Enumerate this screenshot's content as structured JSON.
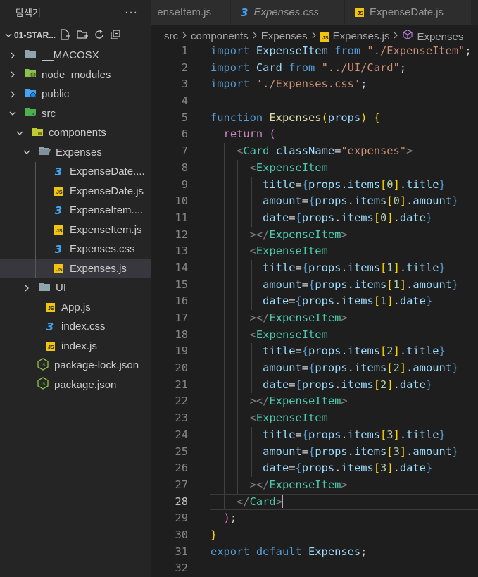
{
  "explorer": {
    "title": "탐색기",
    "more": "···",
    "section": "01-STAR...",
    "items": [
      {
        "label": "__MACOSX",
        "type": "folder",
        "depth": 1,
        "open": false,
        "icon": "folder-icon"
      },
      {
        "label": "node_modules",
        "type": "folder-node",
        "depth": 1,
        "open": false,
        "icon": "node-modules-folder-icon"
      },
      {
        "label": "public",
        "type": "folder-public",
        "depth": 1,
        "open": false,
        "icon": "public-folder-icon"
      },
      {
        "label": "src",
        "type": "folder-src",
        "depth": 1,
        "open": true,
        "icon": "src-folder-icon"
      },
      {
        "label": "components",
        "type": "folder-components",
        "depth": 2,
        "open": true,
        "icon": "components-folder-icon"
      },
      {
        "label": "Expenses",
        "type": "folder",
        "depth": 3,
        "open": true,
        "icon": "folder-open-icon"
      },
      {
        "label": "ExpenseDate....",
        "type": "css",
        "depth": 4,
        "icon": "css-file-icon"
      },
      {
        "label": "ExpenseDate.js",
        "type": "js",
        "depth": 4,
        "icon": "js-file-icon"
      },
      {
        "label": "ExpenseItem....",
        "type": "css",
        "depth": 4,
        "icon": "css-file-icon"
      },
      {
        "label": "ExpenseItem.js",
        "type": "js",
        "depth": 4,
        "icon": "js-file-icon"
      },
      {
        "label": "Expenses.css",
        "type": "css",
        "depth": 4,
        "icon": "css-file-icon"
      },
      {
        "label": "Expenses.js",
        "type": "js",
        "depth": 4,
        "icon": "js-file-icon",
        "selected": true
      },
      {
        "label": "UI",
        "type": "folder",
        "depth": 3,
        "open": false,
        "icon": "folder-icon"
      },
      {
        "label": "App.js",
        "type": "js",
        "depth": 3,
        "icon": "js-file-icon"
      },
      {
        "label": "index.css",
        "type": "css",
        "depth": 3,
        "icon": "css-file-icon"
      },
      {
        "label": "index.js",
        "type": "js",
        "depth": 3,
        "icon": "js-file-icon"
      },
      {
        "label": "package-lock.json",
        "type": "json",
        "depth": 2,
        "icon": "nodejs-file-icon"
      },
      {
        "label": "package.json",
        "type": "json",
        "depth": 2,
        "icon": "nodejs-file-icon"
      }
    ]
  },
  "tabs": [
    {
      "label": "enseItem.js",
      "icon": "js-file-icon",
      "italic": false
    },
    {
      "label": "Expenses.css",
      "icon": "css-file-icon",
      "italic": true
    },
    {
      "label": "ExpenseDate.js",
      "icon": "js-file-icon",
      "italic": false
    }
  ],
  "breadcrumbs": [
    "src",
    "components",
    "Expenses",
    "Expenses.js",
    "Expenses"
  ],
  "editor": {
    "current_line": 28,
    "lines": [
      [
        [
          "key",
          "import "
        ],
        [
          "var",
          "ExpenseItem"
        ],
        [
          "key",
          " from "
        ],
        [
          "str",
          "\"./ExpenseItem\""
        ],
        [
          "plain",
          ";"
        ]
      ],
      [
        [
          "key",
          "import "
        ],
        [
          "var",
          "Card"
        ],
        [
          "key",
          " from "
        ],
        [
          "str",
          "\"../UI/Card\""
        ],
        [
          "plain",
          ";"
        ]
      ],
      [
        [
          "key",
          "import "
        ],
        [
          "str",
          "'./Expenses.css'"
        ],
        [
          "plain",
          ";"
        ]
      ],
      [],
      [
        [
          "key",
          "function "
        ],
        [
          "fn",
          "Expenses"
        ],
        [
          "b1",
          "("
        ],
        [
          "var",
          "props"
        ],
        [
          "b1",
          ")"
        ],
        [
          "plain",
          " "
        ],
        [
          "b1",
          "{"
        ]
      ],
      [
        [
          "plain",
          "  "
        ],
        [
          "kw",
          "return "
        ],
        [
          "b2",
          "("
        ]
      ],
      [
        [
          "plain",
          "    "
        ],
        [
          "pun",
          "<"
        ],
        [
          "tag",
          "Card"
        ],
        [
          "plain",
          " "
        ],
        [
          "attr",
          "className"
        ],
        [
          "plain",
          "="
        ],
        [
          "str",
          "\"expenses\""
        ],
        [
          "pun",
          ">"
        ]
      ],
      [
        [
          "plain",
          "      "
        ],
        [
          "pun",
          "<"
        ],
        [
          "tag",
          "ExpenseItem"
        ]
      ],
      [
        [
          "plain",
          "        "
        ],
        [
          "attr",
          "title"
        ],
        [
          "plain",
          "="
        ],
        [
          "key",
          "{"
        ],
        [
          "var",
          "props"
        ],
        [
          "plain",
          "."
        ],
        [
          "var",
          "items"
        ],
        [
          "b1",
          "["
        ],
        [
          "num",
          "0"
        ],
        [
          "b1",
          "]"
        ],
        [
          "plain",
          "."
        ],
        [
          "var",
          "title"
        ],
        [
          "key",
          "}"
        ]
      ],
      [
        [
          "plain",
          "        "
        ],
        [
          "attr",
          "amount"
        ],
        [
          "plain",
          "="
        ],
        [
          "key",
          "{"
        ],
        [
          "var",
          "props"
        ],
        [
          "plain",
          "."
        ],
        [
          "var",
          "items"
        ],
        [
          "b1",
          "["
        ],
        [
          "num",
          "0"
        ],
        [
          "b1",
          "]"
        ],
        [
          "plain",
          "."
        ],
        [
          "var",
          "amount"
        ],
        [
          "key",
          "}"
        ]
      ],
      [
        [
          "plain",
          "        "
        ],
        [
          "attr",
          "date"
        ],
        [
          "plain",
          "="
        ],
        [
          "key",
          "{"
        ],
        [
          "var",
          "props"
        ],
        [
          "plain",
          "."
        ],
        [
          "var",
          "items"
        ],
        [
          "b1",
          "["
        ],
        [
          "num",
          "0"
        ],
        [
          "b1",
          "]"
        ],
        [
          "plain",
          "."
        ],
        [
          "var",
          "date"
        ],
        [
          "key",
          "}"
        ]
      ],
      [
        [
          "plain",
          "      "
        ],
        [
          "pun",
          "></"
        ],
        [
          "tag",
          "ExpenseItem"
        ],
        [
          "pun",
          ">"
        ]
      ],
      [
        [
          "plain",
          "      "
        ],
        [
          "pun",
          "<"
        ],
        [
          "tag",
          "ExpenseItem"
        ]
      ],
      [
        [
          "plain",
          "        "
        ],
        [
          "attr",
          "title"
        ],
        [
          "plain",
          "="
        ],
        [
          "key",
          "{"
        ],
        [
          "var",
          "props"
        ],
        [
          "plain",
          "."
        ],
        [
          "var",
          "items"
        ],
        [
          "b1",
          "["
        ],
        [
          "num",
          "1"
        ],
        [
          "b1",
          "]"
        ],
        [
          "plain",
          "."
        ],
        [
          "var",
          "title"
        ],
        [
          "key",
          "}"
        ]
      ],
      [
        [
          "plain",
          "        "
        ],
        [
          "attr",
          "amount"
        ],
        [
          "plain",
          "="
        ],
        [
          "key",
          "{"
        ],
        [
          "var",
          "props"
        ],
        [
          "plain",
          "."
        ],
        [
          "var",
          "items"
        ],
        [
          "b1",
          "["
        ],
        [
          "num",
          "1"
        ],
        [
          "b1",
          "]"
        ],
        [
          "plain",
          "."
        ],
        [
          "var",
          "amount"
        ],
        [
          "key",
          "}"
        ]
      ],
      [
        [
          "plain",
          "        "
        ],
        [
          "attr",
          "date"
        ],
        [
          "plain",
          "="
        ],
        [
          "key",
          "{"
        ],
        [
          "var",
          "props"
        ],
        [
          "plain",
          "."
        ],
        [
          "var",
          "items"
        ],
        [
          "b1",
          "["
        ],
        [
          "num",
          "1"
        ],
        [
          "b1",
          "]"
        ],
        [
          "plain",
          "."
        ],
        [
          "var",
          "date"
        ],
        [
          "key",
          "}"
        ]
      ],
      [
        [
          "plain",
          "      "
        ],
        [
          "pun",
          "></"
        ],
        [
          "tag",
          "ExpenseItem"
        ],
        [
          "pun",
          ">"
        ]
      ],
      [
        [
          "plain",
          "      "
        ],
        [
          "pun",
          "<"
        ],
        [
          "tag",
          "ExpenseItem"
        ]
      ],
      [
        [
          "plain",
          "        "
        ],
        [
          "attr",
          "title"
        ],
        [
          "plain",
          "="
        ],
        [
          "key",
          "{"
        ],
        [
          "var",
          "props"
        ],
        [
          "plain",
          "."
        ],
        [
          "var",
          "items"
        ],
        [
          "b1",
          "["
        ],
        [
          "num",
          "2"
        ],
        [
          "b1",
          "]"
        ],
        [
          "plain",
          "."
        ],
        [
          "var",
          "title"
        ],
        [
          "key",
          "}"
        ]
      ],
      [
        [
          "plain",
          "        "
        ],
        [
          "attr",
          "amount"
        ],
        [
          "plain",
          "="
        ],
        [
          "key",
          "{"
        ],
        [
          "var",
          "props"
        ],
        [
          "plain",
          "."
        ],
        [
          "var",
          "items"
        ],
        [
          "b1",
          "["
        ],
        [
          "num",
          "2"
        ],
        [
          "b1",
          "]"
        ],
        [
          "plain",
          "."
        ],
        [
          "var",
          "amount"
        ],
        [
          "key",
          "}"
        ]
      ],
      [
        [
          "plain",
          "        "
        ],
        [
          "attr",
          "date"
        ],
        [
          "plain",
          "="
        ],
        [
          "key",
          "{"
        ],
        [
          "var",
          "props"
        ],
        [
          "plain",
          "."
        ],
        [
          "var",
          "items"
        ],
        [
          "b1",
          "["
        ],
        [
          "num",
          "2"
        ],
        [
          "b1",
          "]"
        ],
        [
          "plain",
          "."
        ],
        [
          "var",
          "date"
        ],
        [
          "key",
          "}"
        ]
      ],
      [
        [
          "plain",
          "      "
        ],
        [
          "pun",
          "></"
        ],
        [
          "tag",
          "ExpenseItem"
        ],
        [
          "pun",
          ">"
        ]
      ],
      [
        [
          "plain",
          "      "
        ],
        [
          "pun",
          "<"
        ],
        [
          "tag",
          "ExpenseItem"
        ]
      ],
      [
        [
          "plain",
          "        "
        ],
        [
          "attr",
          "title"
        ],
        [
          "plain",
          "="
        ],
        [
          "key",
          "{"
        ],
        [
          "var",
          "props"
        ],
        [
          "plain",
          "."
        ],
        [
          "var",
          "items"
        ],
        [
          "b1",
          "["
        ],
        [
          "num",
          "3"
        ],
        [
          "b1",
          "]"
        ],
        [
          "plain",
          "."
        ],
        [
          "var",
          "title"
        ],
        [
          "key",
          "}"
        ]
      ],
      [
        [
          "plain",
          "        "
        ],
        [
          "attr",
          "amount"
        ],
        [
          "plain",
          "="
        ],
        [
          "key",
          "{"
        ],
        [
          "var",
          "props"
        ],
        [
          "plain",
          "."
        ],
        [
          "var",
          "items"
        ],
        [
          "b1",
          "["
        ],
        [
          "num",
          "3"
        ],
        [
          "b1",
          "]"
        ],
        [
          "plain",
          "."
        ],
        [
          "var",
          "amount"
        ],
        [
          "key",
          "}"
        ]
      ],
      [
        [
          "plain",
          "        "
        ],
        [
          "attr",
          "date"
        ],
        [
          "plain",
          "="
        ],
        [
          "key",
          "{"
        ],
        [
          "var",
          "props"
        ],
        [
          "plain",
          "."
        ],
        [
          "var",
          "items"
        ],
        [
          "b1",
          "["
        ],
        [
          "num",
          "3"
        ],
        [
          "b1",
          "]"
        ],
        [
          "plain",
          "."
        ],
        [
          "var",
          "date"
        ],
        [
          "key",
          "}"
        ]
      ],
      [
        [
          "plain",
          "      "
        ],
        [
          "pun",
          "></"
        ],
        [
          "tag",
          "ExpenseItem"
        ],
        [
          "pun",
          ">"
        ]
      ],
      [
        [
          "plain",
          "    "
        ],
        [
          "pun",
          "</"
        ],
        [
          "tag",
          "Card"
        ],
        [
          "pun",
          ">"
        ]
      ],
      [
        [
          "plain",
          "  "
        ],
        [
          "b2",
          ")"
        ],
        [
          "plain",
          ";"
        ]
      ],
      [
        [
          "b1",
          "}"
        ]
      ],
      [
        [
          "key",
          "export "
        ],
        [
          "key",
          "default "
        ],
        [
          "var",
          "Expenses"
        ],
        [
          "plain",
          ";"
        ]
      ],
      []
    ]
  },
  "colors": {
    "background": "#1e1e1e",
    "sidebar": "#252526",
    "selected_row": "#37373d",
    "keyword": "#569cd6",
    "control_keyword": "#c586c0",
    "string": "#ce9178",
    "jsx_tag": "#4ec9b0",
    "variable": "#9cdcfe",
    "function": "#dcdcaa"
  }
}
